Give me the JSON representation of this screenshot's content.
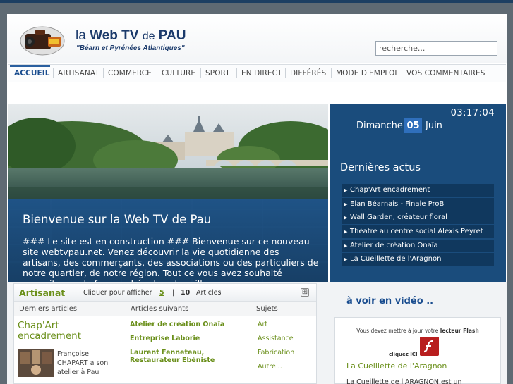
{
  "header": {
    "title_prefix": "la",
    "title_main": "Web TV",
    "title_de": "de",
    "title_city": "PAU",
    "tagline": "\"Béarn et Pyrénées Atlantiques\"",
    "search_placeholder": "recherche..."
  },
  "nav": {
    "items": [
      "ACCUEIL",
      "ARTISANAT",
      "COMMERCE",
      "CULTURE",
      "SPORT",
      "EN DIRECT",
      "DIFFÉRÉS",
      "MODE D'EMPLOI",
      "VOS COMMENTAIRES"
    ],
    "active": "ACCUEIL"
  },
  "hero": {
    "title": "Bienvenue sur la Web TV de Pau",
    "text": "### Le site est en construction ### Bienvenue sur ce nouveau site webtvpau.net. Venez découvrir la vie quotidienne des artisans, des commerçants, des associations ou des particuliers de notre quartier, de notre région. Tout ce vous avez souhaité connaitre sur la face cachée de votre ville."
  },
  "side": {
    "time": "03:17:04",
    "day": "Dimanche",
    "date_num": "05",
    "month": "Juin",
    "news_title": "Dernières actus",
    "news": [
      "Chap'Art encadrement",
      "Elan Béarnais - Finale ProB",
      "Wall Garden, créateur floral",
      "Théatre au centre social Alexis Peyret",
      "Atelier de création Onaïa",
      "La Cueillette de l'Aragnon"
    ]
  },
  "artisanat": {
    "title": "Artisanat",
    "show_label": "Cliquer pour afficher",
    "count_5": "5",
    "separator": "|",
    "count_10": "10",
    "articles_label": "Articles",
    "toggle": "⊞",
    "col_latest": "Derniers articles",
    "col_next": "Articles suivants",
    "col_subjects": "Sujets",
    "latest_title": "Chap'Art encadrement",
    "latest_text": "Françoise CHAPART a son atelier à Pau",
    "next": [
      "Atelier de création Onaïa",
      "Entreprise Laborie",
      "Laurent Fenneteau, Restaurateur Ebéniste"
    ],
    "subjects": [
      "Art",
      "Assistance",
      "Fabrication",
      "Autre .."
    ]
  },
  "video": {
    "title": "à voir en vidéo ..",
    "flash_msg_prefix": "Vous devez mettre à jour votre",
    "flash_msg_bold": "lecteur Flash",
    "flash_click": "cliquez ICI",
    "name": "La Cueillette de l'Aragnon",
    "desc": "La Cueillette de l'ARAGNON est un"
  }
}
